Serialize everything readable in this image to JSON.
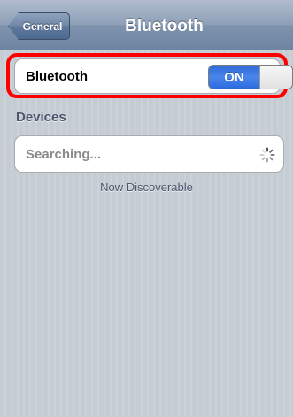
{
  "navbar": {
    "back_label": "General",
    "title": "Bluetooth"
  },
  "bluetooth_row": {
    "label": "Bluetooth",
    "switch_label": "ON",
    "switch_on": true
  },
  "devices": {
    "header": "Devices",
    "status": "Searching...",
    "spinner_icon": "activity-spinner-icon"
  },
  "footer_note": "Now Discoverable",
  "colors": {
    "highlight": "#ff0000",
    "switch_on": "#3478e0",
    "navbar": "#7f93ae",
    "background": "#c5ccd4"
  }
}
